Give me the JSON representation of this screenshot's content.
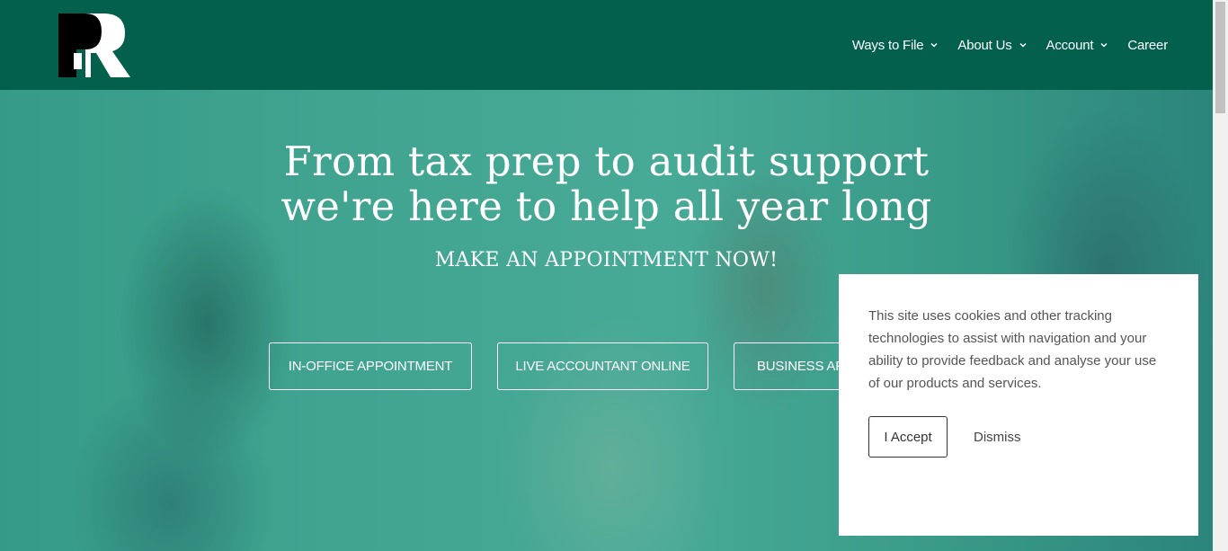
{
  "header": {
    "logo_text": "PR",
    "nav": [
      {
        "label": "Ways to File",
        "has_dropdown": true
      },
      {
        "label": "About Us",
        "has_dropdown": true
      },
      {
        "label": "Account",
        "has_dropdown": true
      },
      {
        "label": "Career",
        "has_dropdown": false
      }
    ]
  },
  "hero": {
    "headline_line1": "From tax prep to audit support",
    "headline_line2": "we're here to help all year long",
    "subhead": "MAKE AN APPOINTMENT NOW!",
    "buttons": [
      {
        "label": "IN-OFFICE APPOINTMENT"
      },
      {
        "label": "LIVE ACCOUNTANT ONLINE"
      },
      {
        "label": "BUSINESS APPOINTMENT"
      }
    ]
  },
  "cookie": {
    "text": "This site uses cookies and other tracking technologies to assist with navigation and your ability to provide feedback and analyse your use of our products and services.",
    "accept_label": "I Accept",
    "dismiss_label": "Dismiss"
  },
  "colors": {
    "header_bg": "#02604c",
    "hero_tint": "#3a9c8a",
    "text_on_dark": "#ffffff"
  }
}
